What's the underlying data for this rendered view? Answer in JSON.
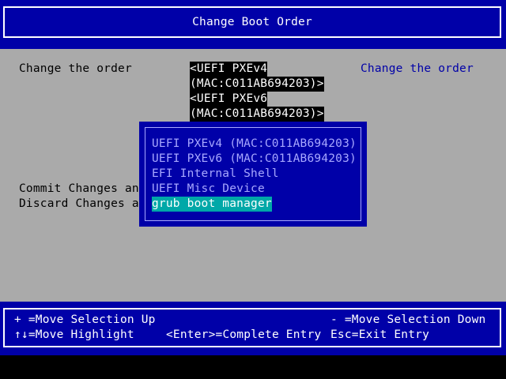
{
  "header": {
    "title": "Change Boot Order"
  },
  "form": {
    "change_order_label": "Change the order",
    "commit_label": "Commit Changes and",
    "discard_label": "Discard Changes and",
    "order_values": [
      "<UEFI PXEv4",
      "(MAC:C011AB694203)>",
      "<UEFI PXEv6",
      "(MAC:C011AB694203)>"
    ]
  },
  "help_panel": {
    "text": "Change the order"
  },
  "popup": {
    "items": [
      "UEFI PXEv4 (MAC:C011AB694203)",
      "UEFI PXEv6 (MAC:C011AB694203)",
      "EFI Internal Shell",
      "UEFI Misc Device",
      "grub boot manager"
    ],
    "selected_index": 4
  },
  "footer": {
    "move_up": "+ =Move Selection Up",
    "move_down": "- =Move Selection Down",
    "move_highlight": "↑↓=Move Highlight",
    "complete_entry": "<Enter>=Complete Entry",
    "exit_entry": "Esc=Exit Entry"
  },
  "colors": {
    "blue": "#0000a8",
    "gray": "#aaaaaa",
    "cyan_highlight": "#00a8a8",
    "light_blue_text": "#a8a8ff"
  }
}
